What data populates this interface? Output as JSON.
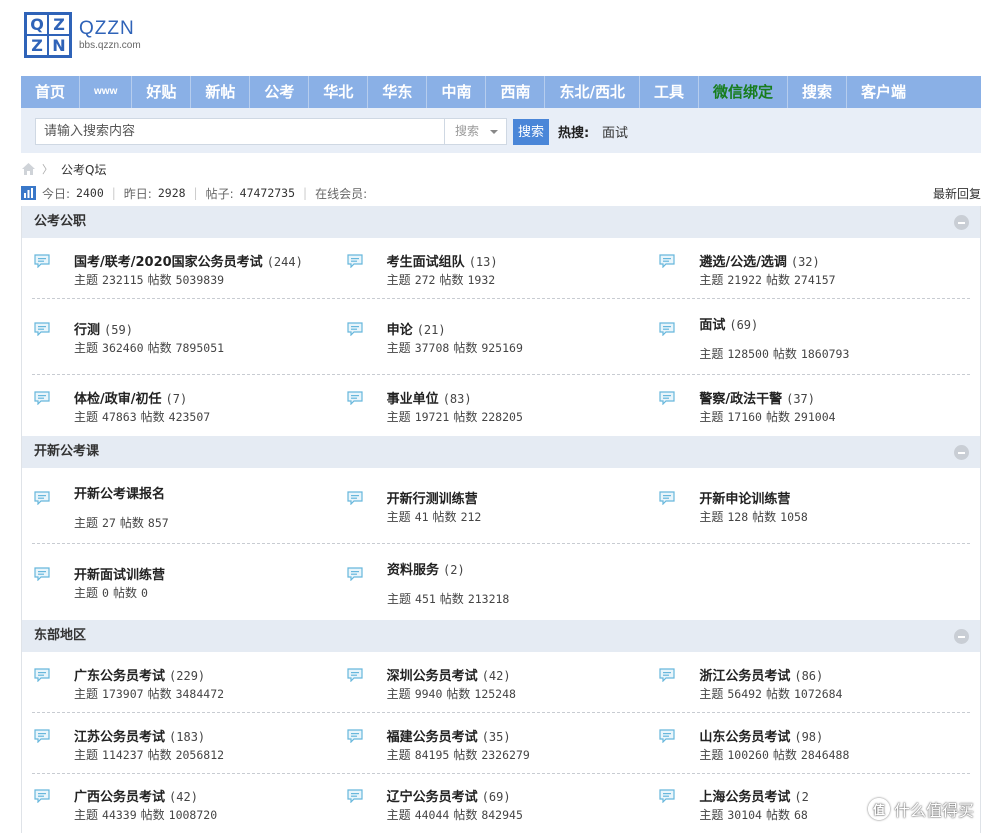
{
  "logo": {
    "letters": [
      "Q",
      "Z",
      "Z",
      "N"
    ],
    "name": "QZZN",
    "url": "bbs.qzzn.com"
  },
  "nav": [
    {
      "label": "首页"
    },
    {
      "label": "www",
      "small": true
    },
    {
      "label": "好贴"
    },
    {
      "label": "新帖"
    },
    {
      "label": "公考"
    },
    {
      "label": "华北"
    },
    {
      "label": "华东"
    },
    {
      "label": "中南"
    },
    {
      "label": "西南"
    },
    {
      "label": "东北/西北"
    },
    {
      "label": "工具"
    },
    {
      "label": "微信绑定",
      "green": true
    },
    {
      "label": "搜索"
    },
    {
      "label": "客户端"
    }
  ],
  "search": {
    "placeholder": "请输入搜索内容",
    "select_label": "搜索",
    "button_label": "搜索",
    "hot_label": "热搜:",
    "hot_word": "面试"
  },
  "breadcrumb": {
    "current": "公考Q坛"
  },
  "stats": {
    "today_label": "今日:",
    "today": "2400",
    "yesterday_label": "昨日:",
    "yesterday": "2928",
    "posts_label": "帖子:",
    "posts": "47472735",
    "online_label": "在线会员:",
    "latest_label": "最新回复"
  },
  "labels": {
    "topics": "主题",
    "posts": "帖数"
  },
  "sections": [
    {
      "title": "公考公职",
      "rows": [
        [
          {
            "title": "国考/联考/2020国家公务员考试",
            "count": "(244)",
            "topics": "232115",
            "posts": "5039839"
          },
          {
            "title": "考生面试组队",
            "count": "(13)",
            "topics": "272",
            "posts": "1932"
          },
          {
            "title": "遴选/公选/选调",
            "count": "(32)",
            "topics": "21922",
            "posts": "274157"
          }
        ],
        [
          {
            "title": "行测",
            "count": "(59)",
            "topics": "362460",
            "posts": "7895051"
          },
          {
            "title": "申论",
            "count": "(21)",
            "topics": "37708",
            "posts": "925169"
          },
          {
            "title": "面试",
            "count": "(69)",
            "topics": "128500",
            "posts": "1860793",
            "spread": true
          }
        ],
        [
          {
            "title": "体检/政审/初任",
            "count": "(7)",
            "topics": "47863",
            "posts": "423507"
          },
          {
            "title": "事业单位",
            "count": "(83)",
            "topics": "19721",
            "posts": "228205"
          },
          {
            "title": "警察/政法干警",
            "count": "(37)",
            "topics": "17160",
            "posts": "291004"
          }
        ]
      ]
    },
    {
      "title": "开新公考课",
      "rows": [
        [
          {
            "title": "开新公考课报名",
            "count": "",
            "topics": "27",
            "posts": "857",
            "spread": true
          },
          {
            "title": "开新行测训练营",
            "count": "",
            "topics": "41",
            "posts": "212"
          },
          {
            "title": "开新申论训练营",
            "count": "",
            "topics": "128",
            "posts": "1058"
          }
        ],
        [
          {
            "title": "开新面试训练营",
            "count": "",
            "topics": "0",
            "posts": "0"
          },
          {
            "title": "资料服务",
            "count": "(2)",
            "topics": "451",
            "posts": "213218",
            "spread": true
          }
        ]
      ]
    },
    {
      "title": "东部地区",
      "rows": [
        [
          {
            "title": "广东公务员考试",
            "count": "(229)",
            "topics": "173907",
            "posts": "3484472"
          },
          {
            "title": "深圳公务员考试",
            "count": "(42)",
            "topics": "9940",
            "posts": "125248"
          },
          {
            "title": "浙江公务员考试",
            "count": "(86)",
            "topics": "56492",
            "posts": "1072684"
          }
        ],
        [
          {
            "title": "江苏公务员考试",
            "count": "(183)",
            "topics": "114237",
            "posts": "2056812"
          },
          {
            "title": "福建公务员考试",
            "count": "(35)",
            "topics": "84195",
            "posts": "2326279"
          },
          {
            "title": "山东公务员考试",
            "count": "(98)",
            "topics": "100260",
            "posts": "2846488"
          }
        ],
        [
          {
            "title": "广西公务员考试",
            "count": "(42)",
            "topics": "44339",
            "posts": "1008720"
          },
          {
            "title": "辽宁公务员考试",
            "count": "(69)",
            "topics": "44044",
            "posts": "842945"
          },
          {
            "title": "上海公务员考试",
            "count": "(2",
            "topics": "30104",
            "posts": "68"
          }
        ]
      ]
    }
  ],
  "watermark": {
    "icon": "值",
    "text": "什么值得买"
  }
}
